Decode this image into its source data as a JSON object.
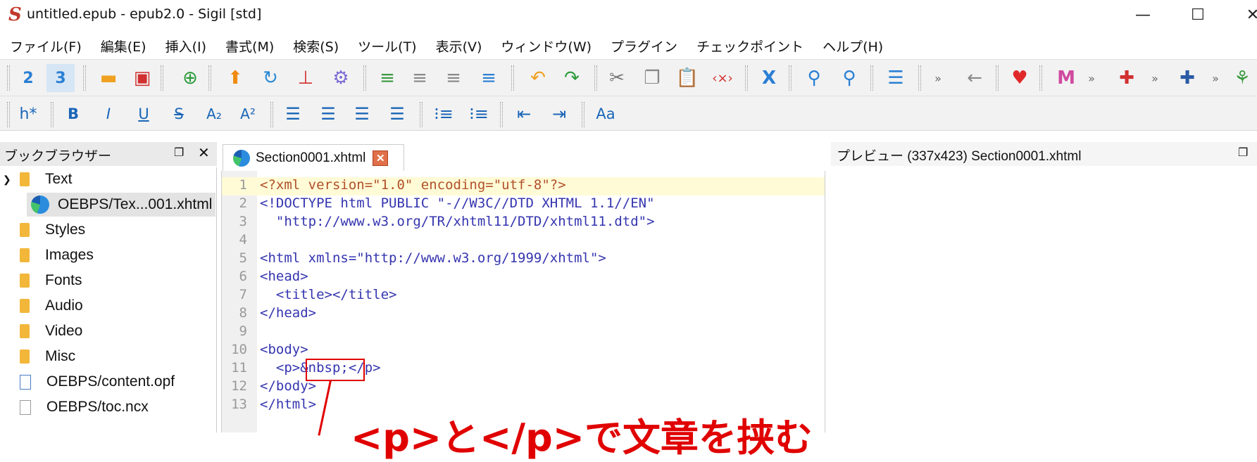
{
  "window": {
    "title": "untitled.epub - epub2.0 - Sigil [std]",
    "minimize": "—",
    "maximize": "☐",
    "close": "✕"
  },
  "menu": [
    "ファイル(F)",
    "編集(E)",
    "挿入(I)",
    "書式(M)",
    "検索(S)",
    "ツール(T)",
    "表示(V)",
    "ウィンドウ(W)",
    "プラグイン",
    "チェックポイント",
    "ヘルプ(H)"
  ],
  "toolbar2": {
    "heading": "h*",
    "bold": "B",
    "italic": "I",
    "underline": "U",
    "strike": "S",
    "subscript": "A₂",
    "superscript": "A²",
    "case": "Aa"
  },
  "book_browser": {
    "title": "ブックブラウザー",
    "items": [
      {
        "label": "Text",
        "type": "folder"
      },
      {
        "label": "OEBPS/Tex...001.xhtml",
        "type": "xhtml"
      },
      {
        "label": "Styles",
        "type": "folder"
      },
      {
        "label": "Images",
        "type": "folder"
      },
      {
        "label": "Fonts",
        "type": "folder"
      },
      {
        "label": "Audio",
        "type": "folder"
      },
      {
        "label": "Video",
        "type": "folder"
      },
      {
        "label": "Misc",
        "type": "folder"
      },
      {
        "label": "OEBPS/content.opf",
        "type": "opf"
      },
      {
        "label": "OEBPS/toc.ncx",
        "type": "file"
      }
    ]
  },
  "editor": {
    "tab_label": "Section0001.xhtml",
    "line_numbers": [
      "1",
      "2",
      "3",
      "4",
      "5",
      "6",
      "7",
      "8",
      "9",
      "10",
      "11",
      "12",
      "13"
    ],
    "lines": [
      "<?xml version=\"1.0\" encoding=\"utf-8\"?>",
      "<!DOCTYPE html PUBLIC \"-//W3C//DTD XHTML 1.1//EN\"",
      "  \"http://www.w3.org/TR/xhtml11/DTD/xhtml11.dtd\">",
      "",
      "<html xmlns=\"http://www.w3.org/1999/xhtml\">",
      "<head>",
      "  <title></title>",
      "</head>",
      "",
      "<body>",
      "  <p>&nbsp;</p>",
      "</body>",
      "</html>"
    ]
  },
  "annotation": {
    "text": "<p>と</p>で文章を挟む"
  },
  "preview": {
    "title": "プレビュー (337x423) Section0001.xhtml"
  },
  "colors": {
    "accent_red": "#e00000",
    "highlight_line": "#fffbd6"
  }
}
